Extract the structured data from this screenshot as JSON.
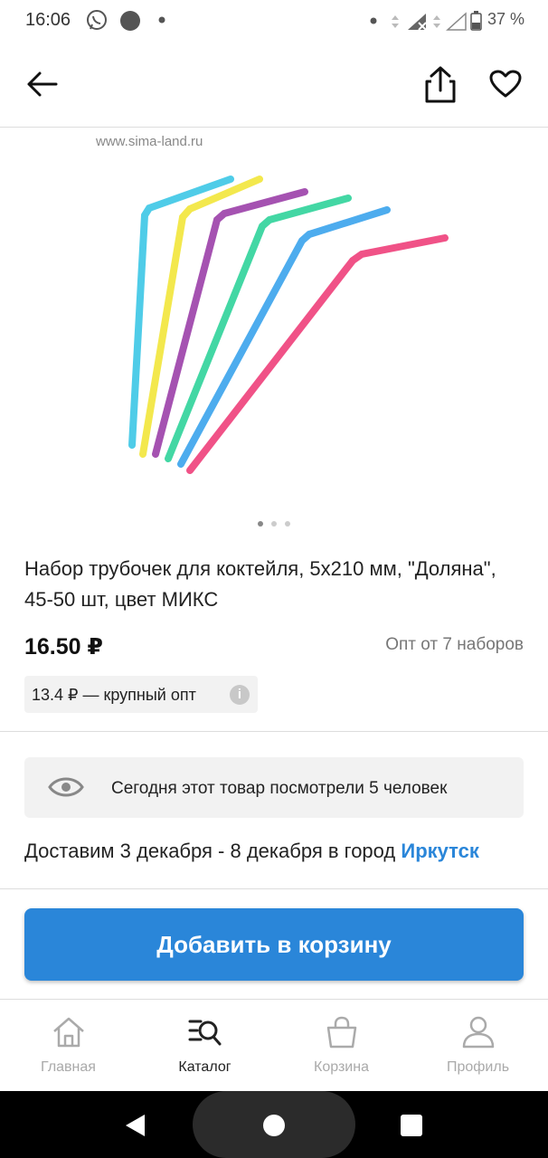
{
  "status_bar": {
    "time": "16:06",
    "battery": "37 %"
  },
  "product": {
    "watermark": "www.sima-land.ru",
    "title": "Набор трубочек для коктейля, 5х210 мм, \"Доляна\", 45-50 шт, цвет МИКС",
    "price": "16.50 ₽",
    "wholesale_min": "Опт от 7 наборов",
    "bulk_price": "13.4 ₽ — крупный опт",
    "image_count": 3,
    "current_image": 1
  },
  "views": {
    "text": "Сегодня этот товар посмотрели 5 человек"
  },
  "delivery": {
    "text": "Доставим 3 декабря - 8 декабря в город ",
    "city": "Иркутск"
  },
  "actions": {
    "add_to_cart": "Добавить в корзину"
  },
  "bottom_nav": {
    "items": [
      {
        "label": "Главная",
        "icon": "home-icon",
        "active": false
      },
      {
        "label": "Каталог",
        "icon": "catalog-search-icon",
        "active": true
      },
      {
        "label": "Корзина",
        "icon": "cart-bag-icon",
        "active": false
      },
      {
        "label": "Профиль",
        "icon": "profile-icon",
        "active": false
      }
    ]
  },
  "colors": {
    "accent": "#2a86d9",
    "straws": [
      "#3cc6e6",
      "#f2e53a",
      "#9b3fa8",
      "#2fd39a",
      "#3aa3ec",
      "#ee3f7a"
    ]
  }
}
